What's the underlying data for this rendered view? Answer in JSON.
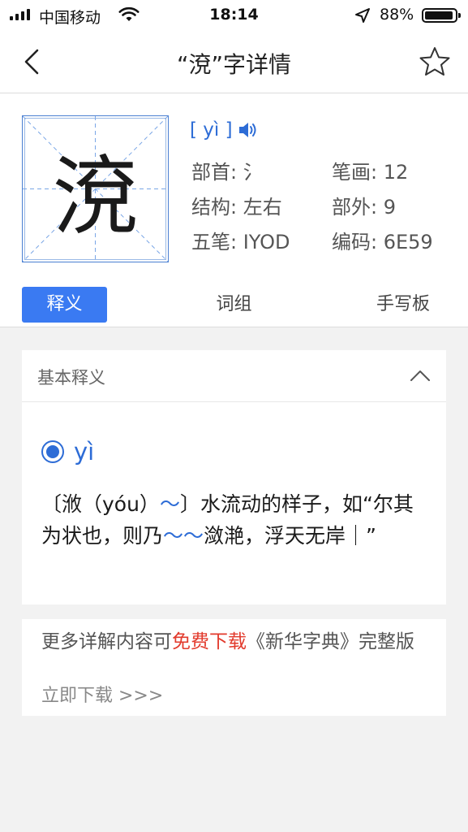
{
  "status_bar": {
    "carrier": "中国移动",
    "time": "18:14",
    "battery_percent": "88%",
    "battery_level": 0.88
  },
  "nav": {
    "title": "“渷”字详情"
  },
  "character": {
    "glyph": "渷",
    "pinyin": "[ yì ]",
    "radical_label": "部首: 氵",
    "strokes_label": "笔画: 12",
    "structure_label": "结构: 左右",
    "extra_strokes_label": "部外: 9",
    "wubi_label": "五笔: IYOD",
    "code_label": "编码: 6E59"
  },
  "tabs": [
    {
      "label": "释义",
      "active": true
    },
    {
      "label": "词组",
      "active": false
    },
    {
      "label": "手写板",
      "active": false
    }
  ],
  "basic_meaning": {
    "header": "基本释义",
    "pinyin": "yì",
    "def_part1": "〔浟（yóu）",
    "def_tilde1": "～",
    "def_part2": "〕水流动的样子，如“尔其为状也，则乃",
    "def_tilde2": "～～",
    "def_part3": "潋滟，浮天无岸｜”"
  },
  "promo": {
    "text_before": "更多详解内容可",
    "text_red": "免费下载",
    "text_after": "《新华字典》完整版",
    "link": "立即下载 >>>"
  },
  "colors": {
    "accent": "#3a7af2",
    "link_blue": "#2d6cd6",
    "promo_red": "#e23a2c"
  }
}
